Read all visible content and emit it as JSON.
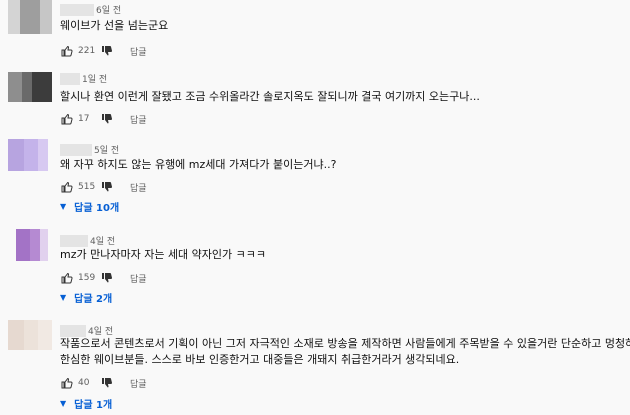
{
  "comments": [
    {
      "time": "6일 전",
      "text_lines": [
        "웨이브가 선을 넘는군요"
      ],
      "likes": "221",
      "reply_label": "답글",
      "avatar_colors": [
        "#d4d4d4",
        "#9e9e9e",
        "#c6c6c6"
      ]
    },
    {
      "time": "1일 전",
      "text_lines": [
        "할시나 환연 이런게 잘됐고 조금 수위올라간 솔로지옥도 잘되니까 결국 여기까지 오는구나..."
      ],
      "likes": "17",
      "reply_label": "답글",
      "avatar_colors": [
        "#8e8e8e",
        "#6a6a6a",
        "#3c3c3c"
      ]
    },
    {
      "time": "5일 전",
      "text_lines": [
        "왜 자꾸 하지도 않는 유행에 mz세대 가져다가 붙이는거냐..?"
      ],
      "likes": "515",
      "reply_label": "답글",
      "replies_label": "답글 10개",
      "avatar_colors": [
        "#b7a4e0",
        "#c4b3ea",
        "#d7c9f1"
      ]
    },
    {
      "time": "4일 전",
      "text_lines": [
        "mz가 만나자마자 자는 세대 약자인가 ㅋㅋㅋ"
      ],
      "likes": "159",
      "reply_label": "답글",
      "replies_label": "답글 2개",
      "avatar_colors": [
        "#a373c6",
        "#b58ad2",
        "#e1d1ee"
      ]
    },
    {
      "time": "4일 전",
      "text_lines": [
        "작품으로서 콘텐츠로서 기획이 아닌 그저 자극적인 소재로 방송을 제작하면 사람들에게 주목받을 수 있을거란 단순하고 멍청하고",
        "한심한 웨이브분들. 스스로 바보 인증한거고 대중들은 개돼지 취급한거라거 생각되네요."
      ],
      "likes": "40",
      "reply_label": "답글",
      "replies_label": "답글 1개",
      "avatar_colors": [
        "#e6d9d0",
        "#ece2da",
        "#f1e9e3"
      ]
    }
  ],
  "icons": {
    "like": "thumb-up-icon",
    "dislike": "thumb-down-icon",
    "expand": "chevron-down-icon"
  }
}
